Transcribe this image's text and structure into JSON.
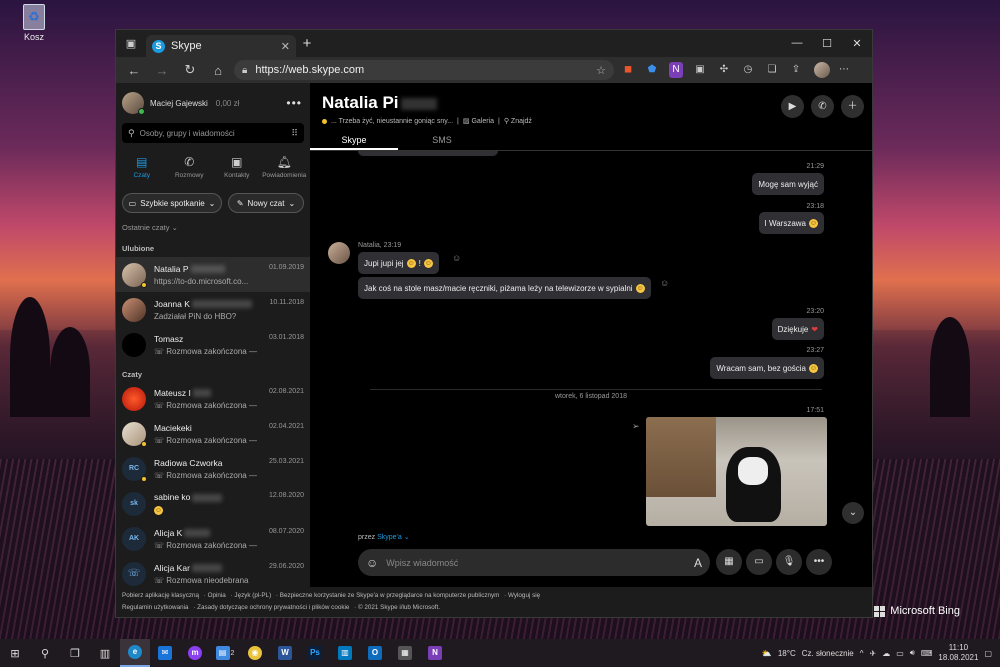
{
  "desktop": {
    "recycle_label": "Kosz",
    "watermark": "Microsoft Bing"
  },
  "browser": {
    "tab_title": "Skype",
    "url": "https://web.skype.com"
  },
  "sidebar": {
    "user_name": "Maciej Gajewski",
    "credit": "0,00 zł",
    "search_placeholder": "Osoby, grupy i wiadomości",
    "nav": [
      {
        "label": "Czaty",
        "icon": "chat-icon",
        "active": true
      },
      {
        "label": "Rozmowy",
        "icon": "phone-icon",
        "active": false
      },
      {
        "label": "Kontakty",
        "icon": "contacts-icon",
        "active": false
      },
      {
        "label": "Powiadomienia",
        "icon": "bell-icon",
        "active": false
      }
    ],
    "meet_now": "Szybkie spotkanie",
    "new_chat": "Nowy czat",
    "recent_header": "Ostatnie czaty",
    "favorites_header": "Ulubione",
    "chats_header": "Czaty",
    "favorites": [
      {
        "name": "Natalia P",
        "date": "01.09.2019",
        "preview": "https://to-do.microsoft.co...",
        "selected": true
      },
      {
        "name": "Joanna K",
        "date": "10.11.2018",
        "preview": "Zadziałał PiN do HBO?"
      },
      {
        "name": "Tomasz",
        "date": "03.01.2018",
        "preview": "Rozmowa zakończona —"
      }
    ],
    "chats": [
      {
        "name": "Mateusz I",
        "date": "02.08.2021",
        "preview": "Rozmowa zakończona —",
        "initials": ""
      },
      {
        "name": "Maciekeki",
        "date": "02.04.2021",
        "preview": "Rozmowa zakończona —",
        "initials": ""
      },
      {
        "name": "Radiowa Czworka",
        "date": "25.03.2021",
        "preview": "Rozmowa zakończona —",
        "initials": "RC"
      },
      {
        "name": "sabine ko",
        "date": "12.08.2020",
        "preview": "",
        "initials": "sk"
      },
      {
        "name": "Alicja K",
        "date": "08.07.2020",
        "preview": "Rozmowa zakończona —",
        "initials": "AK"
      },
      {
        "name": "Alicja Kar",
        "date": "29.06.2020",
        "preview": "Rozmowa nieodebrana",
        "initials": ""
      }
    ]
  },
  "conversation": {
    "contact_name": "Natalia Pi",
    "mood": "... Trzeba żyć, nieustannie goniąc sny...",
    "gallery": "Galeria",
    "find": "Znajdź",
    "tabs": [
      "Skype",
      "SMS"
    ],
    "messages": {
      "t1": "21:29",
      "m1": "Mogę sam wyjąć",
      "t2": "23:18",
      "m2": "I Warszawa",
      "sender": "Natalia, 23:19",
      "m3": "Jupi jupi jej",
      "m4": "Jak coś na stole masz/macie ręczniki, piżama leży na telewizorze w sypialni",
      "t3": "23:20",
      "m5": "Dziękuje",
      "t4": "23:27",
      "m6": "Wracam sam, bez gościa",
      "date_divider": "wtorek, 6 listopad 2018",
      "t5": "17:51"
    },
    "via": "przez",
    "via_link": "Skype'a",
    "compose_placeholder": "Wpisz wiadomość"
  },
  "footer": {
    "line1": [
      "Pobierz aplikację klasyczną",
      "Opinia",
      "Język (pl-PL)",
      "Bezpieczne korzystanie ze Skype'a w przeglądarce na komputerze publicznym",
      "Wyloguj się"
    ],
    "line2": [
      "Regulamin użytkowania",
      "Zasady dotyczące ochrony prywatności i plików cookie",
      "© 2021 Skype i/lub Microsoft."
    ]
  },
  "taskbar": {
    "temperature": "18°C",
    "weather": "Cz. słonecznie",
    "time": "11:10",
    "date": "18.08.2021",
    "badge": "2"
  },
  "colors": {
    "accent": "#1b9ae0",
    "status_away": "#f2c12e",
    "status_online": "#3fb950"
  }
}
